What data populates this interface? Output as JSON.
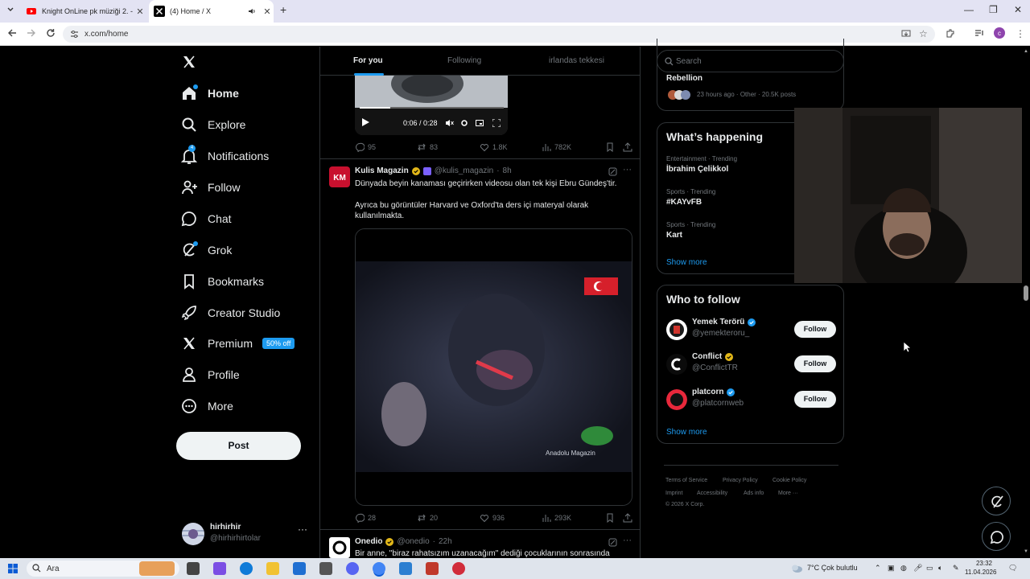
{
  "browser": {
    "tabs": [
      {
        "title": "Knight OnLine pk müziği 2. - Yo"
      },
      {
        "title": "(4) Home / X"
      }
    ],
    "url": "x.com/home"
  },
  "sidebar": {
    "items": [
      {
        "label": "Home"
      },
      {
        "label": "Explore"
      },
      {
        "label": "Notifications",
        "badge": "4"
      },
      {
        "label": "Follow"
      },
      {
        "label": "Chat"
      },
      {
        "label": "Grok"
      },
      {
        "label": "Bookmarks"
      },
      {
        "label": "Creator Studio"
      },
      {
        "label": "Premium",
        "badge": "50% off"
      },
      {
        "label": "Profile"
      },
      {
        "label": "More"
      }
    ],
    "post_label": "Post",
    "account": {
      "name": "hirhirhir",
      "handle": "@hirhirhirtolar"
    }
  },
  "feed": {
    "tabs": [
      "For you",
      "Following",
      "irlandas tekkesi"
    ],
    "video1": {
      "time": "0:06 / 0:28",
      "progress": 0.21,
      "replies": "95",
      "reposts": "83",
      "likes": "1.8K",
      "views": "782K"
    },
    "tweet2": {
      "name": "Kulis Magazin",
      "handle": "@kulis_magazin",
      "time": "8h",
      "line1": "Dünyada beyin kanaması geçirirken videosu olan tek kişi Ebru Gündeş'tir.",
      "line2": "Ayrıca bu görüntüler Harvard ve Oxford'ta ders içi materyal olarak kullanılmakta.",
      "watermark": "Anadolu Magazin",
      "replies": "28",
      "reposts": "20",
      "likes": "936",
      "views": "293K"
    },
    "tweet3": {
      "name": "Onedio",
      "handle": "@onedio",
      "time": "22h",
      "text": "Bir anne, \"biraz rahatsızım uzanacağım\" dediği çocuklarının sonrasında"
    }
  },
  "right": {
    "search_placeholder": "Search",
    "top_trend": {
      "title": "Rebellion",
      "meta": "23 hours ago · Other · 20.5K posts"
    },
    "happening_title": "What’s happening",
    "trends": [
      {
        "meta": "Entertainment · Trending",
        "name": "İbrahim Çelikkol"
      },
      {
        "meta": "Sports · Trending",
        "name": "#KAYvFB"
      },
      {
        "meta": "Sports · Trending",
        "name": "Kart"
      }
    ],
    "show_more": "Show more",
    "wtf_title": "Who to follow",
    "follow_label": "Follow",
    "suggestions": [
      {
        "name": "Yemek Terörü",
        "handle": "@yemekteroru_"
      },
      {
        "name": "Conflict",
        "handle": "@ConflictTR"
      },
      {
        "name": "platcorn",
        "handle": "@platcornweb"
      }
    ],
    "footer": [
      "Terms of Service",
      "Privacy Policy",
      "Cookie Policy",
      "Imprint",
      "Accessibility",
      "Ads info",
      "More ···",
      "© 2026 X Corp."
    ]
  },
  "taskbar": {
    "search": "Ara",
    "weather": "7°C  Çok bulutlu",
    "time": "23:32",
    "date": "11.04.2026"
  },
  "colors": {
    "accent": "#1d9bf0",
    "gold": "#e2b719"
  }
}
